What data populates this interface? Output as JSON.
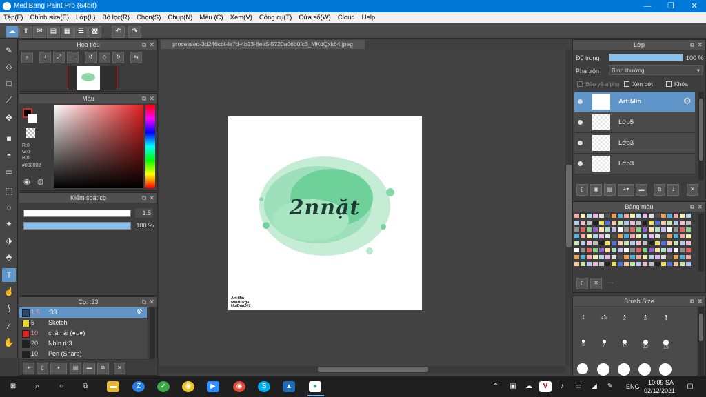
{
  "window": {
    "title": "MediBang Paint Pro (64bit)",
    "minimize": "—",
    "restore": "❐",
    "close": "✕"
  },
  "menu": [
    "Tệp(F)",
    "Chỉnh sửa(E)",
    "Lớp(L)",
    "Bộ lọc(R)",
    "Chọn(S)",
    "Chụp(N)",
    "Màu (C)",
    "Xem(V)",
    "Công cụ(T)",
    "Cửa sổ(W)",
    "Cloud",
    "Help"
  ],
  "canvas_tab": "processed-3d246cbf-fe7d-4b23-8ea5-5720a06b0fc3_MKdQxk64.jpeg",
  "navigator": {
    "title": "Hoa tiêu"
  },
  "color": {
    "title": "Màu",
    "r": "R:0",
    "g": "G:0",
    "b": "B:0",
    "hex": "#000000",
    "primary": "#000000"
  },
  "brush_control": {
    "title": "Kiểm soát cọ",
    "size": "1.5",
    "opacity": "100 %"
  },
  "brushes": {
    "title": "Cọ: :33",
    "items": [
      {
        "size": "1.5",
        "name": ":33",
        "color": "#2a4a6a"
      },
      {
        "size": "5",
        "name": "Sketch",
        "color": "#e8d820"
      },
      {
        "size": "10",
        "name": "chân ái (●ᴗ●)",
        "color": "#e02020"
      },
      {
        "size": "20",
        "name": "Nhìn rì:3",
        "color": "#202020"
      },
      {
        "size": "10",
        "name": "Pen (Sharp)",
        "color": "#202020"
      }
    ]
  },
  "artwork": {
    "text": "2nnặt",
    "signature": [
      "Art:Min",
      "MinBukga",
      "HoiDap247"
    ]
  },
  "layers": {
    "title": "Lớp",
    "opacity_label": "Độ trong",
    "opacity_value": "100 %",
    "blend_label": "Pha trộn",
    "blend_value": "Bình thường",
    "protect_alpha": "Bảo vệ alpha",
    "clipping": "Xén bớt",
    "lock": "Khóa",
    "items": [
      {
        "name": "Art:Min",
        "selected": true
      },
      {
        "name": "Lớp5",
        "selected": false
      },
      {
        "name": "Lớp3",
        "selected": false
      },
      {
        "name": "Lớp3",
        "selected": false
      }
    ]
  },
  "palette": {
    "title": "Bảng màu",
    "footer": "---"
  },
  "brush_size": {
    "title": "Brush Size",
    "sizes": [
      "1",
      "1.5",
      "2",
      "3",
      "4",
      "5",
      "7",
      "10",
      "12",
      "15"
    ]
  },
  "taskbar": {
    "lang": "ENG",
    "time": "10:09 SA",
    "date": "02/12/2021"
  }
}
